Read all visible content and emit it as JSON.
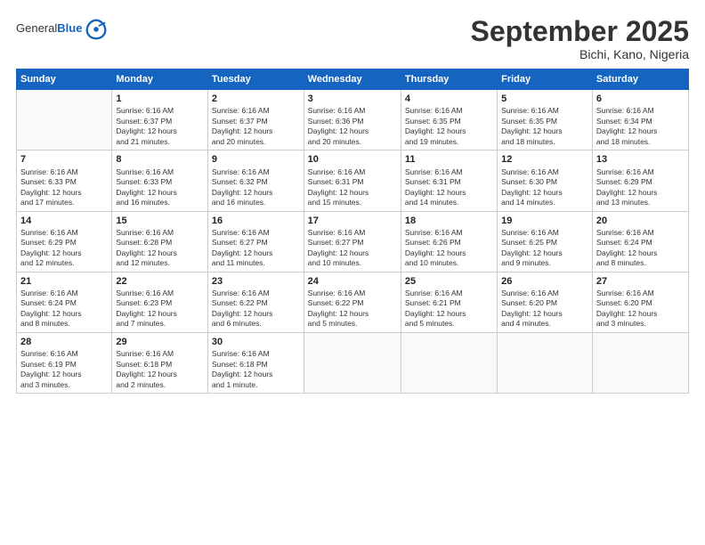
{
  "header": {
    "logo_general": "General",
    "logo_blue": "Blue",
    "month_title": "September 2025",
    "location": "Bichi, Kano, Nigeria"
  },
  "weekdays": [
    "Sunday",
    "Monday",
    "Tuesday",
    "Wednesday",
    "Thursday",
    "Friday",
    "Saturday"
  ],
  "weeks": [
    [
      {
        "day": "",
        "info": ""
      },
      {
        "day": "1",
        "info": "Sunrise: 6:16 AM\nSunset: 6:37 PM\nDaylight: 12 hours\nand 21 minutes."
      },
      {
        "day": "2",
        "info": "Sunrise: 6:16 AM\nSunset: 6:37 PM\nDaylight: 12 hours\nand 20 minutes."
      },
      {
        "day": "3",
        "info": "Sunrise: 6:16 AM\nSunset: 6:36 PM\nDaylight: 12 hours\nand 20 minutes."
      },
      {
        "day": "4",
        "info": "Sunrise: 6:16 AM\nSunset: 6:35 PM\nDaylight: 12 hours\nand 19 minutes."
      },
      {
        "day": "5",
        "info": "Sunrise: 6:16 AM\nSunset: 6:35 PM\nDaylight: 12 hours\nand 18 minutes."
      },
      {
        "day": "6",
        "info": "Sunrise: 6:16 AM\nSunset: 6:34 PM\nDaylight: 12 hours\nand 18 minutes."
      }
    ],
    [
      {
        "day": "7",
        "info": "Sunrise: 6:16 AM\nSunset: 6:33 PM\nDaylight: 12 hours\nand 17 minutes."
      },
      {
        "day": "8",
        "info": "Sunrise: 6:16 AM\nSunset: 6:33 PM\nDaylight: 12 hours\nand 16 minutes."
      },
      {
        "day": "9",
        "info": "Sunrise: 6:16 AM\nSunset: 6:32 PM\nDaylight: 12 hours\nand 16 minutes."
      },
      {
        "day": "10",
        "info": "Sunrise: 6:16 AM\nSunset: 6:31 PM\nDaylight: 12 hours\nand 15 minutes."
      },
      {
        "day": "11",
        "info": "Sunrise: 6:16 AM\nSunset: 6:31 PM\nDaylight: 12 hours\nand 14 minutes."
      },
      {
        "day": "12",
        "info": "Sunrise: 6:16 AM\nSunset: 6:30 PM\nDaylight: 12 hours\nand 14 minutes."
      },
      {
        "day": "13",
        "info": "Sunrise: 6:16 AM\nSunset: 6:29 PM\nDaylight: 12 hours\nand 13 minutes."
      }
    ],
    [
      {
        "day": "14",
        "info": "Sunrise: 6:16 AM\nSunset: 6:29 PM\nDaylight: 12 hours\nand 12 minutes."
      },
      {
        "day": "15",
        "info": "Sunrise: 6:16 AM\nSunset: 6:28 PM\nDaylight: 12 hours\nand 12 minutes."
      },
      {
        "day": "16",
        "info": "Sunrise: 6:16 AM\nSunset: 6:27 PM\nDaylight: 12 hours\nand 11 minutes."
      },
      {
        "day": "17",
        "info": "Sunrise: 6:16 AM\nSunset: 6:27 PM\nDaylight: 12 hours\nand 10 minutes."
      },
      {
        "day": "18",
        "info": "Sunrise: 6:16 AM\nSunset: 6:26 PM\nDaylight: 12 hours\nand 10 minutes."
      },
      {
        "day": "19",
        "info": "Sunrise: 6:16 AM\nSunset: 6:25 PM\nDaylight: 12 hours\nand 9 minutes."
      },
      {
        "day": "20",
        "info": "Sunrise: 6:16 AM\nSunset: 6:24 PM\nDaylight: 12 hours\nand 8 minutes."
      }
    ],
    [
      {
        "day": "21",
        "info": "Sunrise: 6:16 AM\nSunset: 6:24 PM\nDaylight: 12 hours\nand 8 minutes."
      },
      {
        "day": "22",
        "info": "Sunrise: 6:16 AM\nSunset: 6:23 PM\nDaylight: 12 hours\nand 7 minutes."
      },
      {
        "day": "23",
        "info": "Sunrise: 6:16 AM\nSunset: 6:22 PM\nDaylight: 12 hours\nand 6 minutes."
      },
      {
        "day": "24",
        "info": "Sunrise: 6:16 AM\nSunset: 6:22 PM\nDaylight: 12 hours\nand 5 minutes."
      },
      {
        "day": "25",
        "info": "Sunrise: 6:16 AM\nSunset: 6:21 PM\nDaylight: 12 hours\nand 5 minutes."
      },
      {
        "day": "26",
        "info": "Sunrise: 6:16 AM\nSunset: 6:20 PM\nDaylight: 12 hours\nand 4 minutes."
      },
      {
        "day": "27",
        "info": "Sunrise: 6:16 AM\nSunset: 6:20 PM\nDaylight: 12 hours\nand 3 minutes."
      }
    ],
    [
      {
        "day": "28",
        "info": "Sunrise: 6:16 AM\nSunset: 6:19 PM\nDaylight: 12 hours\nand 3 minutes."
      },
      {
        "day": "29",
        "info": "Sunrise: 6:16 AM\nSunset: 6:18 PM\nDaylight: 12 hours\nand 2 minutes."
      },
      {
        "day": "30",
        "info": "Sunrise: 6:16 AM\nSunset: 6:18 PM\nDaylight: 12 hours\nand 1 minute."
      },
      {
        "day": "",
        "info": ""
      },
      {
        "day": "",
        "info": ""
      },
      {
        "day": "",
        "info": ""
      },
      {
        "day": "",
        "info": ""
      }
    ]
  ]
}
